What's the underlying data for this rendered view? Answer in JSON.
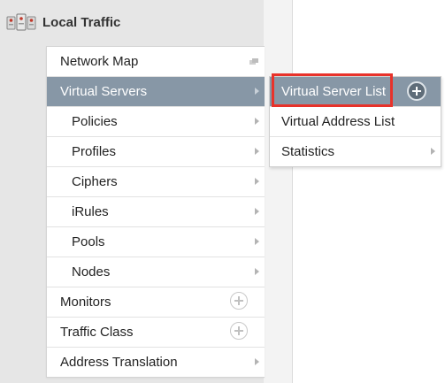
{
  "section": {
    "title": "Local Traffic",
    "icon": "local-traffic-icon"
  },
  "menu": {
    "items": [
      {
        "label": "Network Map",
        "icon": "window-icon"
      },
      {
        "label": "Virtual Servers",
        "active": true
      },
      {
        "label": "Policies"
      },
      {
        "label": "Profiles"
      },
      {
        "label": "Ciphers"
      },
      {
        "label": "iRules"
      },
      {
        "label": "Pools"
      },
      {
        "label": "Nodes"
      },
      {
        "label": "Monitors",
        "icon": "plus-circle-icon"
      },
      {
        "label": "Traffic Class",
        "icon": "plus-circle-icon"
      },
      {
        "label": "Address Translation"
      }
    ]
  },
  "submenu": {
    "items": [
      {
        "label": "Virtual Server List",
        "active": true,
        "icon": "create-plus-icon"
      },
      {
        "label": "Virtual Address List"
      },
      {
        "label": "Statistics"
      }
    ]
  },
  "colors": {
    "active_bg": "#8797a6",
    "highlight_border": "#e8322a",
    "panel_bg": "#e6e6e6"
  }
}
